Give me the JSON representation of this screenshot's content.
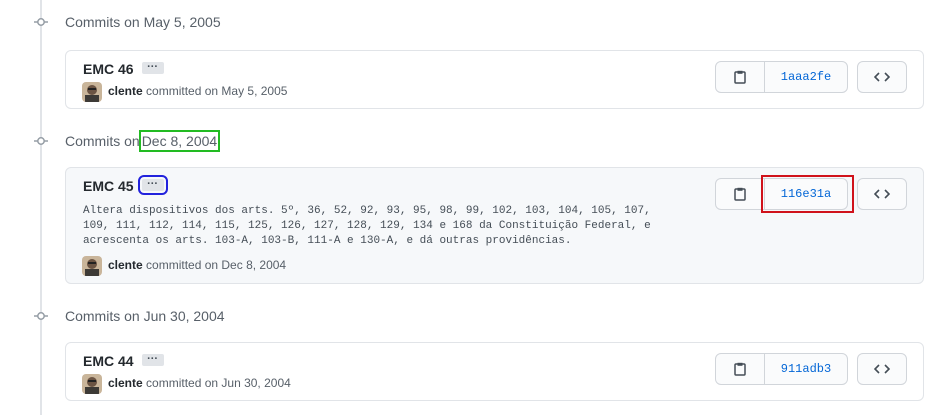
{
  "colors": {
    "link": "#0366d6",
    "muted": "#586069",
    "border": "#e1e4e8",
    "highlight_date": "#22bb22",
    "highlight_ellipsis": "#2222dd",
    "highlight_sha": "#d0121b"
  },
  "icons": {
    "commit_node": "git-commit-icon",
    "ellipsis": "kebab-horizontal-icon",
    "copy": "clippy-icon",
    "browse": "code-icon"
  },
  "groups": [
    {
      "prefix": "Commits on",
      "date": "May 5, 2005",
      "commits": [
        {
          "title": "EMC 46",
          "ellipsis": "···",
          "body": "",
          "author": "clente",
          "committed_text": "committed on May 5, 2005",
          "sha": "1aaa2fe"
        }
      ]
    },
    {
      "prefix": "Commits on",
      "date": "Dec 8, 2004",
      "commits": [
        {
          "title": "EMC 45",
          "ellipsis": "···",
          "body": "Altera dispositivos dos arts. 5º, 36, 52, 92, 93, 95, 98, 99, 102, 103, 104, 105, 107,\n109, 111, 112, 114, 115, 125, 126, 127, 128, 129, 134 e 168 da Constituição Federal, e\nacrescenta os arts. 103-A, 103-B, 111-A e 130-A, e dá outras providências.",
          "author": "clente",
          "committed_text": "committed on Dec 8, 2004",
          "sha": "116e31a"
        }
      ]
    },
    {
      "prefix": "Commits on",
      "date": "Jun 30, 2004",
      "commits": [
        {
          "title": "EMC 44",
          "ellipsis": "···",
          "body": "",
          "author": "clente",
          "committed_text": "committed on Jun 30, 2004",
          "sha": "911adb3"
        }
      ]
    }
  ]
}
